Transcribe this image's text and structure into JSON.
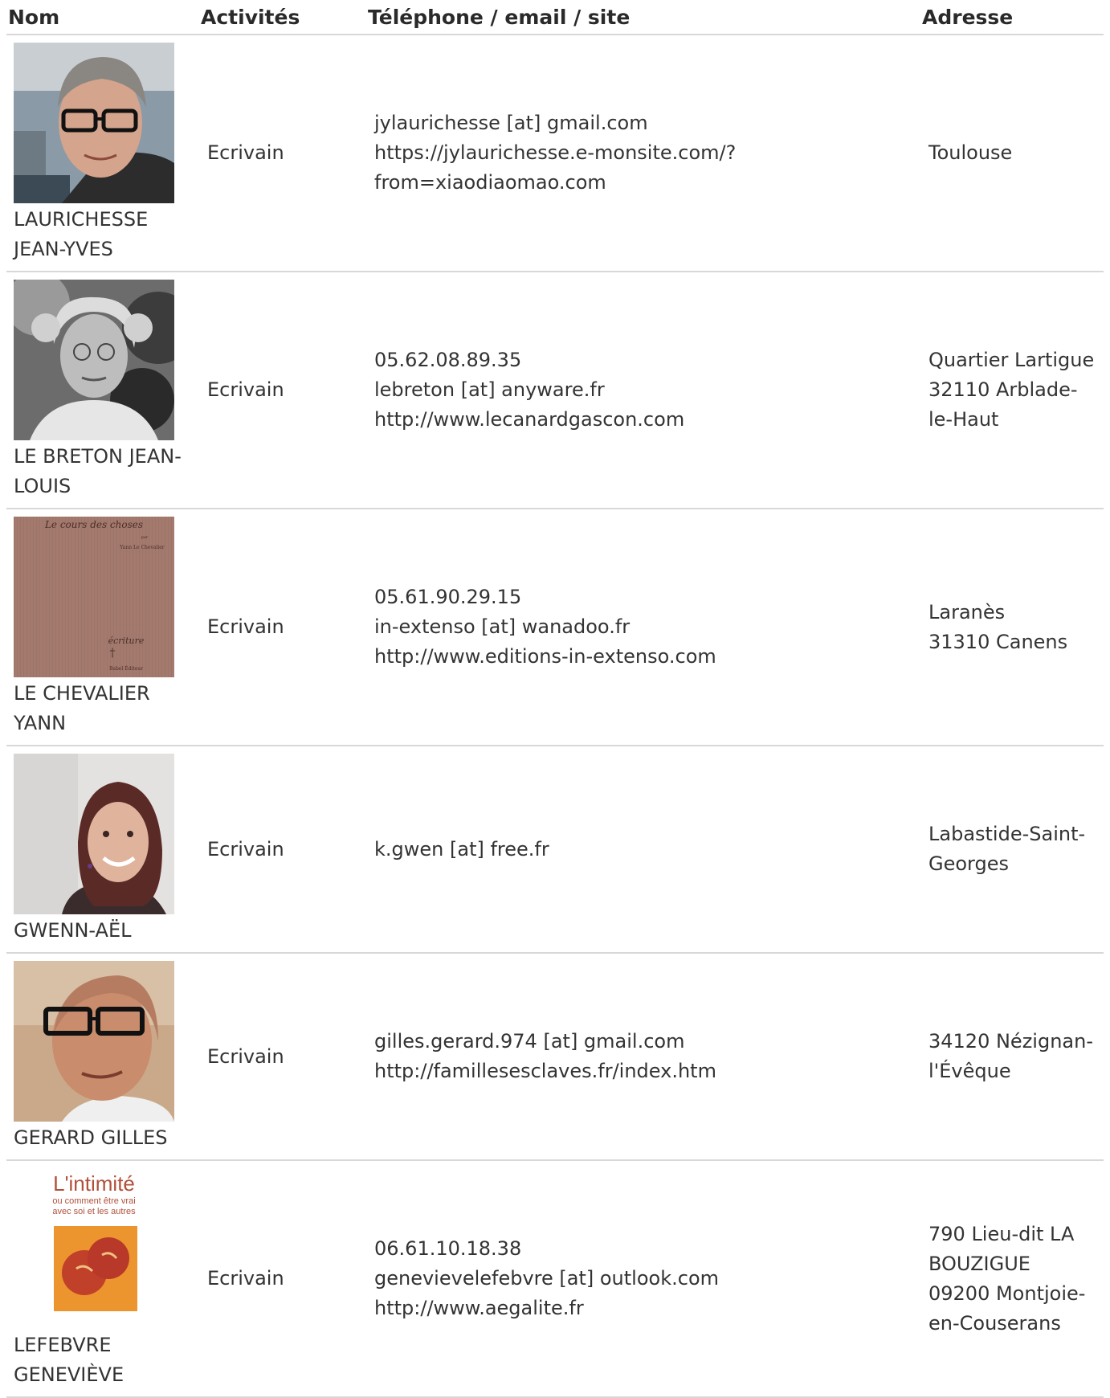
{
  "headers": {
    "nom": "Nom",
    "activites": "Activités",
    "contact": "Téléphone / email / site",
    "adresse": "Adresse"
  },
  "rows": [
    {
      "name": "LAURICHESSE JEAN-YVES",
      "photo": "portrait-photo",
      "activity": "Ecrivain",
      "contact": [
        "jylaurichesse [at] gmail.com",
        "https://jylaurichesse.e-monsite.com/?from=xiaodiaomao.com"
      ],
      "address": [
        "Toulouse"
      ]
    },
    {
      "name": "LE BRETON JEAN-LOUIS",
      "photo": "portrait-photo",
      "activity": "Ecrivain",
      "contact": [
        "05.62.08.89.35",
        "lebreton [at] anyware.fr",
        "http://www.lecanardgascon.com"
      ],
      "address": [
        "Quartier Lartigue",
        "32110 Arblade-le-Haut"
      ]
    },
    {
      "name": "LE CHEVALIER YANN",
      "photo": "book-cover",
      "book": {
        "title": "Le cours des choses",
        "by": "par",
        "author": "Yann Le Chevalier",
        "collection": "écriture",
        "publisher": "Babel Éditeur"
      },
      "activity": "Ecrivain",
      "contact": [
        "05.61.90.29.15",
        "in-extenso [at] wanadoo.fr",
        "http://www.editions-in-extenso.com"
      ],
      "address": [
        "Laranès",
        "31310 Canens"
      ]
    },
    {
      "name": "GWENN-AËL",
      "photo": "portrait-photo",
      "activity": "Ecrivain",
      "contact": [
        "k.gwen [at] free.fr"
      ],
      "address": [
        "Labastide-Saint-Georges"
      ]
    },
    {
      "name": "GERARD GILLES",
      "photo": "portrait-photo",
      "activity": "Ecrivain",
      "contact": [
        "gilles.gerard.974 [at] gmail.com",
        "http://famillesesclaves.fr/index.htm"
      ],
      "address": [
        "34120 Nézignan-l'Évêque"
      ]
    },
    {
      "name": "LEFEBVRE GENEVIÈVE",
      "photo": "book-cover",
      "book": {
        "title": "L'intimité",
        "subtitle_1": "ou comment être vrai",
        "subtitle_2": "avec soi et les autres"
      },
      "activity": "Ecrivain",
      "contact": [
        "06.61.10.18.38",
        "genevievelefebvre [at] outlook.com",
        "http://www.aegalite.fr"
      ],
      "address": [
        "790 Lieu-dit LA BOUZIGUE",
        "09200 Montjoie-en-Couserans"
      ]
    }
  ]
}
